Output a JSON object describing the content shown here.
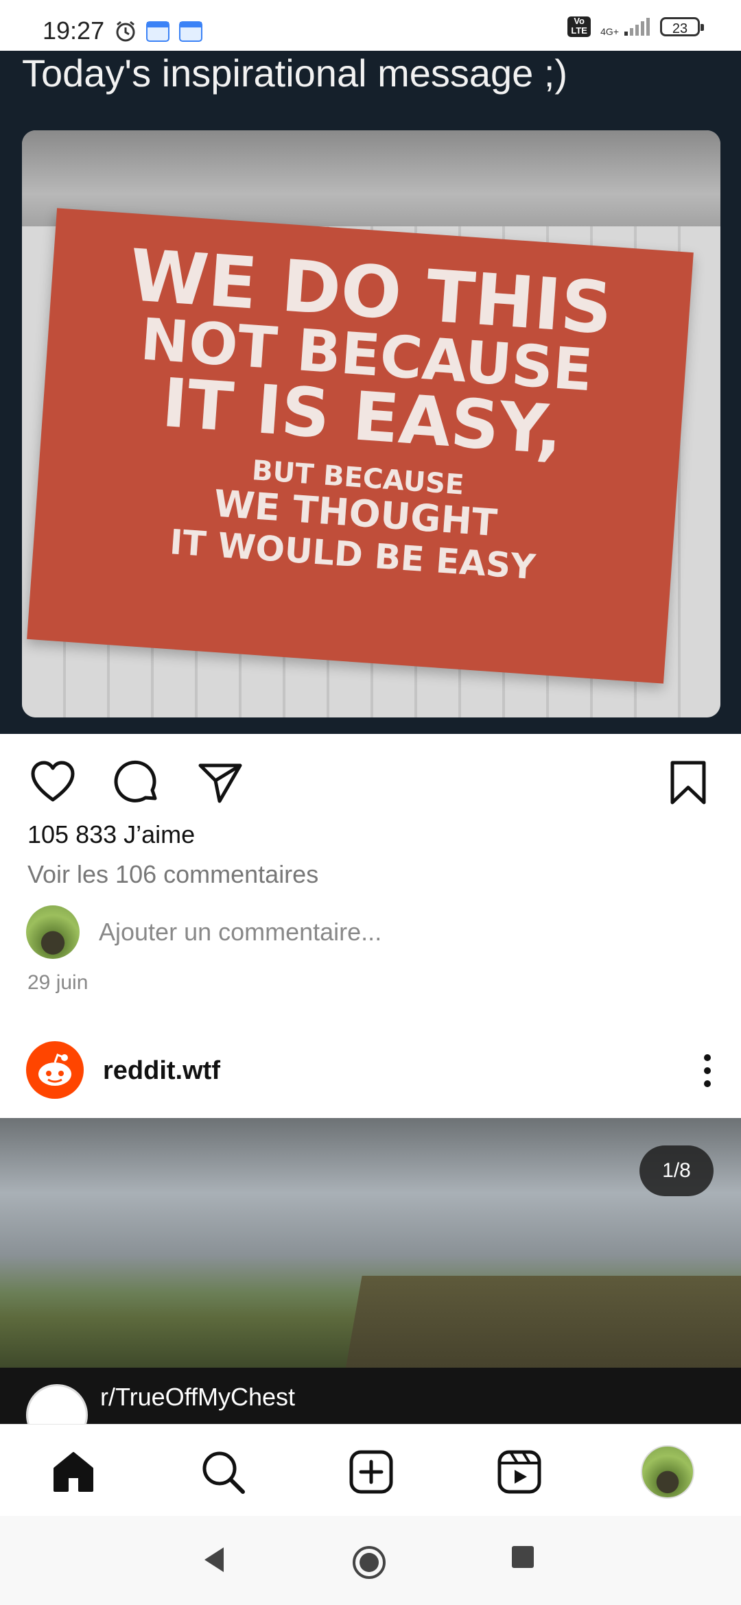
{
  "status_bar": {
    "time": "19:27",
    "network": "4G+",
    "volte": "Vo LTE",
    "battery": "23"
  },
  "tweet": {
    "text": "Today's inspirational message ;)",
    "flag_lines": [
      "WE DO THIS",
      "NOT BECAUSE",
      "IT IS EASY,",
      "BUT BECAUSE",
      "WE THOUGHT",
      "IT WOULD BE EASY"
    ]
  },
  "post1": {
    "likes": "105 833 J’aime",
    "view_comments": "Voir les 106 commentaires",
    "add_comment_placeholder": "Ajouter un commentaire...",
    "date": "29 juin"
  },
  "post2": {
    "username": "reddit.wtf",
    "carousel_counter": "1/8",
    "embedded_title": "r/TrueOffMyChest"
  },
  "colors": {
    "tweet_bg": "#15202b",
    "flag": "#c04e3a",
    "reddit": "#ff4500"
  },
  "icons": {
    "like": "heart-icon",
    "comment": "comment-icon",
    "share": "send-icon",
    "save": "bookmark-icon",
    "more": "more-vertical-icon",
    "home": "home-icon",
    "search": "search-icon",
    "create": "add-square-icon",
    "reels": "reels-icon"
  }
}
